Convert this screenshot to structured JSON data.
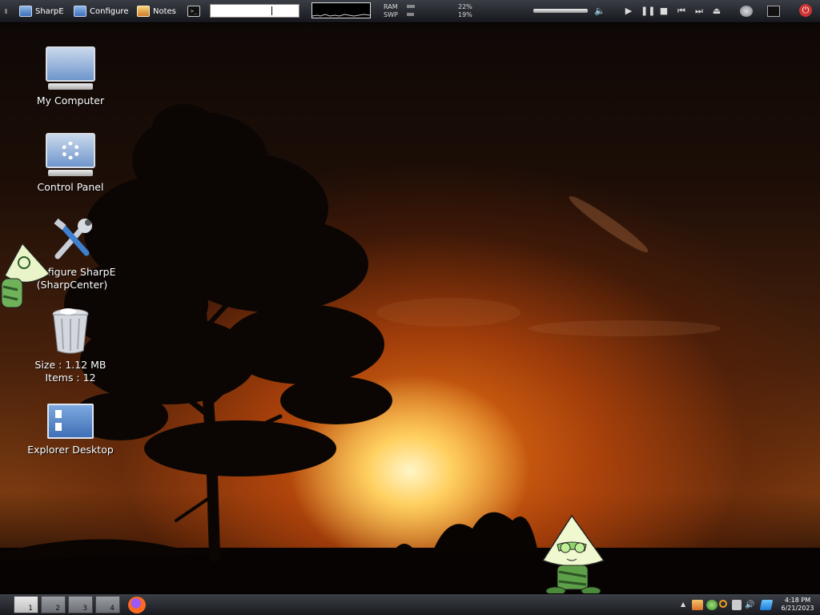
{
  "top_panel": {
    "sharpe_label": "SharpE",
    "configure_label": "Configure",
    "notes_label": "Notes",
    "terminal_glyph": ">_",
    "ram_label": "RAM",
    "swp_label": "SWP",
    "ram_pct": "22%",
    "swp_pct": "19%",
    "ram_fraction": 0.22,
    "swp_fraction": 0.19
  },
  "desktop_icons": {
    "my_computer": "My Computer",
    "control_panel": "Control Panel",
    "configure_line1": "Configure SharpE",
    "configure_line2": "(SharpCenter)",
    "recycle_size": "Size : 1.12 MB",
    "recycle_items": "Items : 12",
    "explorer_desktop": "Explorer Desktop"
  },
  "bottom_panel": {
    "workspaces": [
      "1",
      "2",
      "3",
      "4"
    ],
    "active_workspace": "1",
    "tray_arrow": "▲",
    "clock_time": "4:18 PM",
    "clock_date": "6/21/2023"
  },
  "colors": {
    "panel": "#2a2c32",
    "sun": "#fff6c8",
    "sky_glow": "#e07818",
    "mascot": "#bfe89a"
  }
}
